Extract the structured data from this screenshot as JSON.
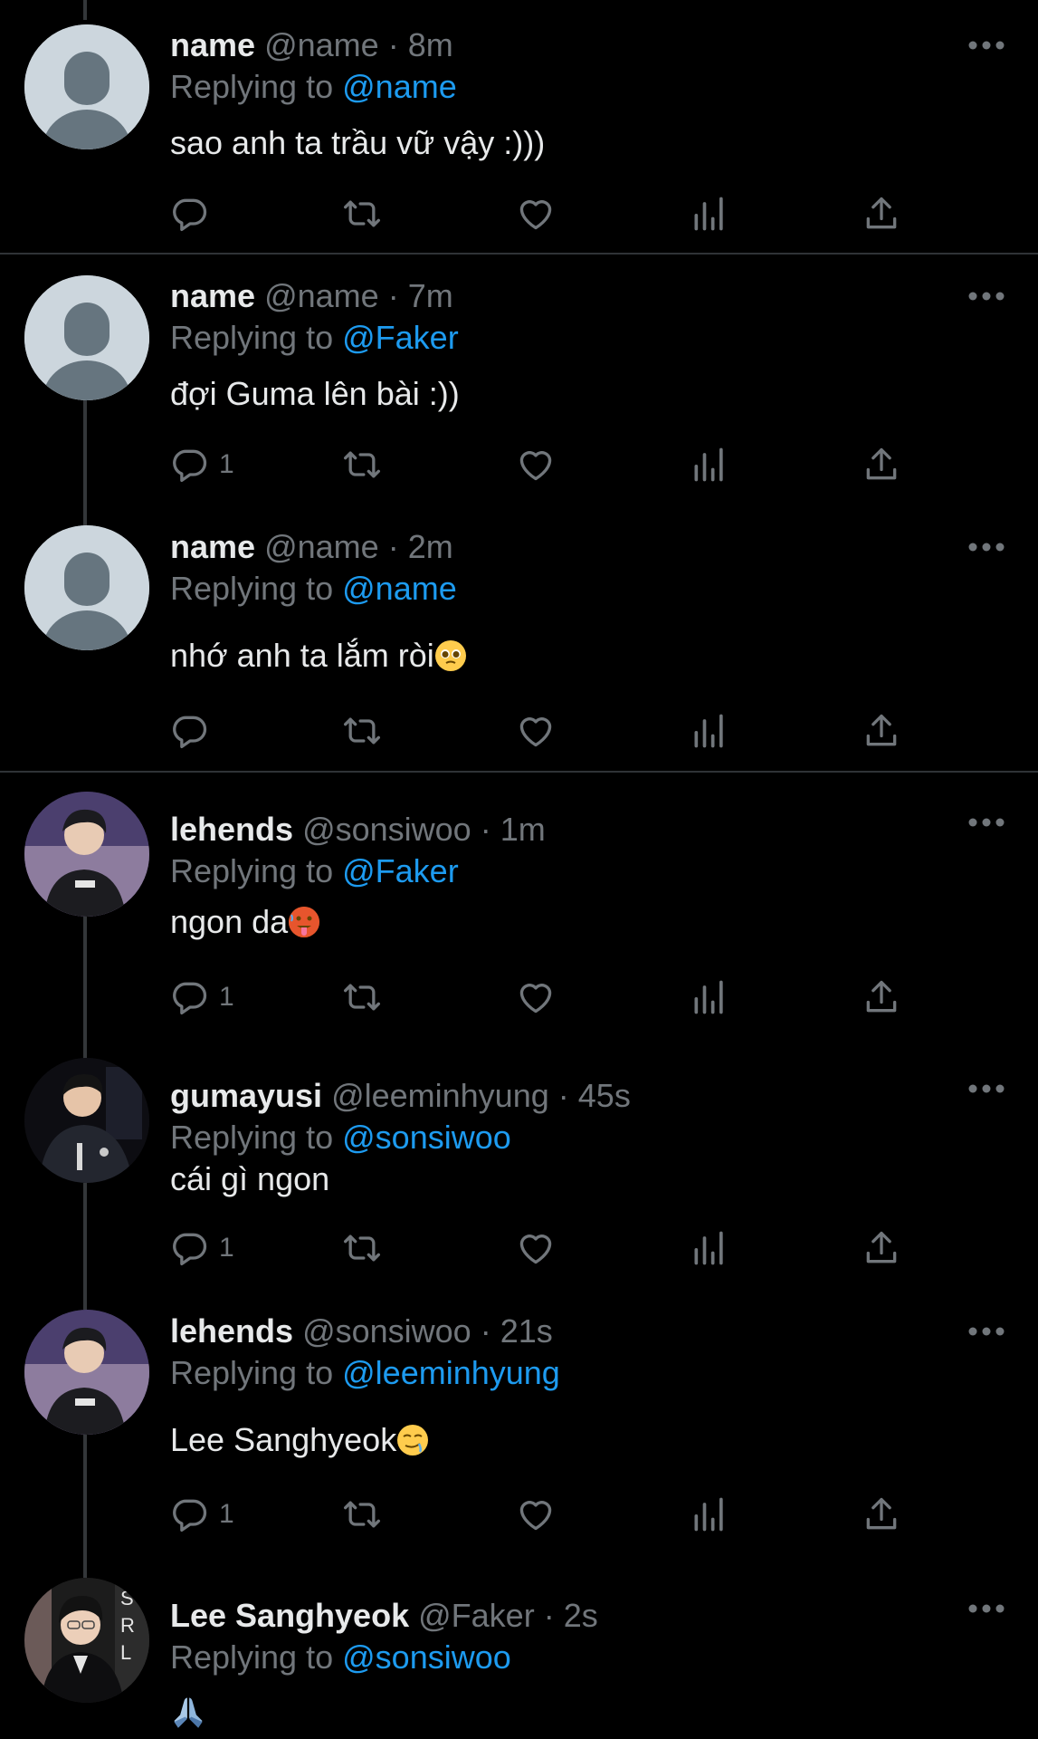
{
  "tweets": [
    {
      "display_name": "name",
      "handle": "@name",
      "time": "8m",
      "reply_prefix": "Replying to",
      "reply_to": "@name",
      "text": "sao anh ta trầu vữ vậy :)))",
      "reply_count": ""
    },
    {
      "display_name": "name",
      "handle": "@name",
      "time": "7m",
      "reply_prefix": "Replying to",
      "reply_to": "@Faker",
      "text": "đợi Guma lên bài :))",
      "reply_count": "1"
    },
    {
      "display_name": "name",
      "handle": "@name",
      "time": "2m",
      "reply_prefix": "Replying to",
      "reply_to": "@name",
      "text": "nhớ anh ta lắm ròi",
      "reply_count": ""
    },
    {
      "display_name": "lehends",
      "handle": "@sonsiwoo",
      "time": "1m",
      "reply_prefix": "Replying to",
      "reply_to": "@Faker",
      "text": "ngon da",
      "reply_count": "1"
    },
    {
      "display_name": "gumayusi",
      "handle": "@leeminhyung",
      "time": "45s",
      "reply_prefix": "Replying to",
      "reply_to": "@sonsiwoo",
      "text": "cái gì ngon",
      "reply_count": "1"
    },
    {
      "display_name": "lehends",
      "handle": "@sonsiwoo",
      "time": "21s",
      "reply_prefix": "Replying to",
      "reply_to": "@leeminhyung",
      "text": "Lee Sanghyeok",
      "reply_count": "1"
    },
    {
      "display_name": "Lee Sanghyeok",
      "handle": "@Faker",
      "time": "2s",
      "reply_prefix": "Replying to",
      "reply_to": "@sonsiwoo",
      "text": ""
    }
  ],
  "separator": "·",
  "colors": {
    "background": "#000000",
    "text": "#e7e9ea",
    "muted": "#71767b",
    "accent": "#1d9bf0",
    "divider": "#2f3336"
  }
}
